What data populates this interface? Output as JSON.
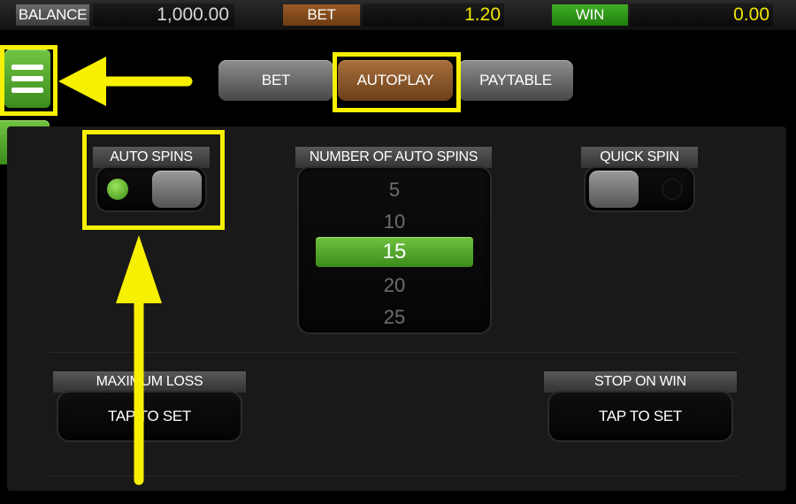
{
  "topbar": {
    "balance_label": "BALANCE",
    "balance_value": "1,000.00",
    "bet_label": "BET",
    "bet_value": "1.20",
    "win_label": "WIN",
    "win_value": "0.00"
  },
  "tabs": [
    {
      "label": "BET",
      "active": false
    },
    {
      "label": "AUTOPLAY",
      "active": true
    },
    {
      "label": "PAYTABLE",
      "active": false
    }
  ],
  "autoplay": {
    "auto_spins_label": "AUTO SPINS",
    "auto_spins_on": true,
    "number_label": "NUMBER OF AUTO SPINS",
    "spin_options": [
      "5",
      "10",
      "15",
      "20",
      "25"
    ],
    "selected": "15",
    "quick_spin_label": "QUICK SPIN",
    "quick_spin_on": false,
    "max_loss_label": "MAXIMUM LOSS",
    "max_loss_button": "TAP TO SET",
    "stop_on_win_label": "STOP ON WIN",
    "stop_on_win_button": "TAP TO SET"
  },
  "icons": {
    "menu": "hamburger-menu-icon",
    "back": "arrow-left-icon"
  },
  "colors": {
    "accent_green": "#4aa52a",
    "active_tab": "#8a5428",
    "annotation": "#f7f000",
    "value_yellow": "#f2e600"
  }
}
